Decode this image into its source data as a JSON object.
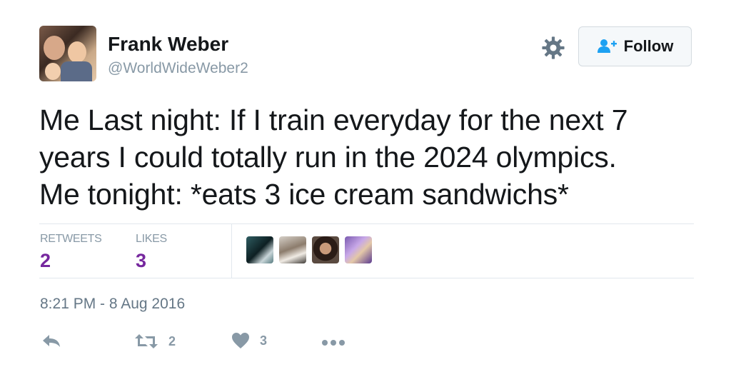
{
  "user": {
    "name": "Frank Weber",
    "handle": "@WorldWideWeber2"
  },
  "header": {
    "follow_label": "Follow",
    "icons": [
      "gear-icon",
      "follow-person-icon"
    ]
  },
  "tweet": {
    "text": "Me Last night: If I train everyday for the next 7\nyears I could totally run in the 2024 olympics.\nMe tonight: *eats 3 ice cream sandwichs*"
  },
  "stats": {
    "retweets_label": "RETWEETS",
    "retweets_value": "2",
    "likes_label": "LIKES",
    "likes_value": "3"
  },
  "timestamp": "8:21 PM - 8 Aug 2016",
  "actions": {
    "retweet_count": "2",
    "like_count": "3",
    "icons": [
      "reply-icon",
      "retweet-icon",
      "heart-icon",
      "more-icon"
    ]
  },
  "colors": {
    "stat_value": "#76279e",
    "muted": "#8899a6",
    "text": "#14171a"
  }
}
